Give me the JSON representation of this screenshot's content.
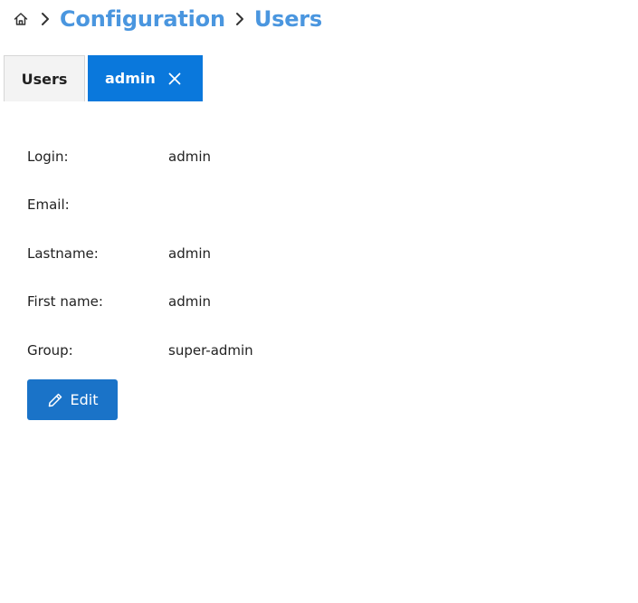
{
  "breadcrumb": {
    "home_icon": "home-icon",
    "separator_icon": "chevron-right-icon",
    "items": [
      "Configuration",
      "Users"
    ]
  },
  "tabs": [
    {
      "label": "Users",
      "active": false
    },
    {
      "label": "admin",
      "active": true,
      "close_icon": "close-icon"
    }
  ],
  "details": {
    "login": {
      "label": "Login:",
      "value": "admin"
    },
    "email": {
      "label": "Email:",
      "value": ""
    },
    "lastname": {
      "label": "Lastname:",
      "value": "admin"
    },
    "first_name": {
      "label": "First name:",
      "value": "admin"
    },
    "group": {
      "label": "Group:",
      "value": "super-admin"
    }
  },
  "actions": {
    "edit_label": "Edit",
    "edit_icon": "pencil-icon"
  },
  "colors": {
    "accent": "#0a78dc",
    "breadcrumb_link": "#4a96df",
    "button": "#1a73c8"
  }
}
